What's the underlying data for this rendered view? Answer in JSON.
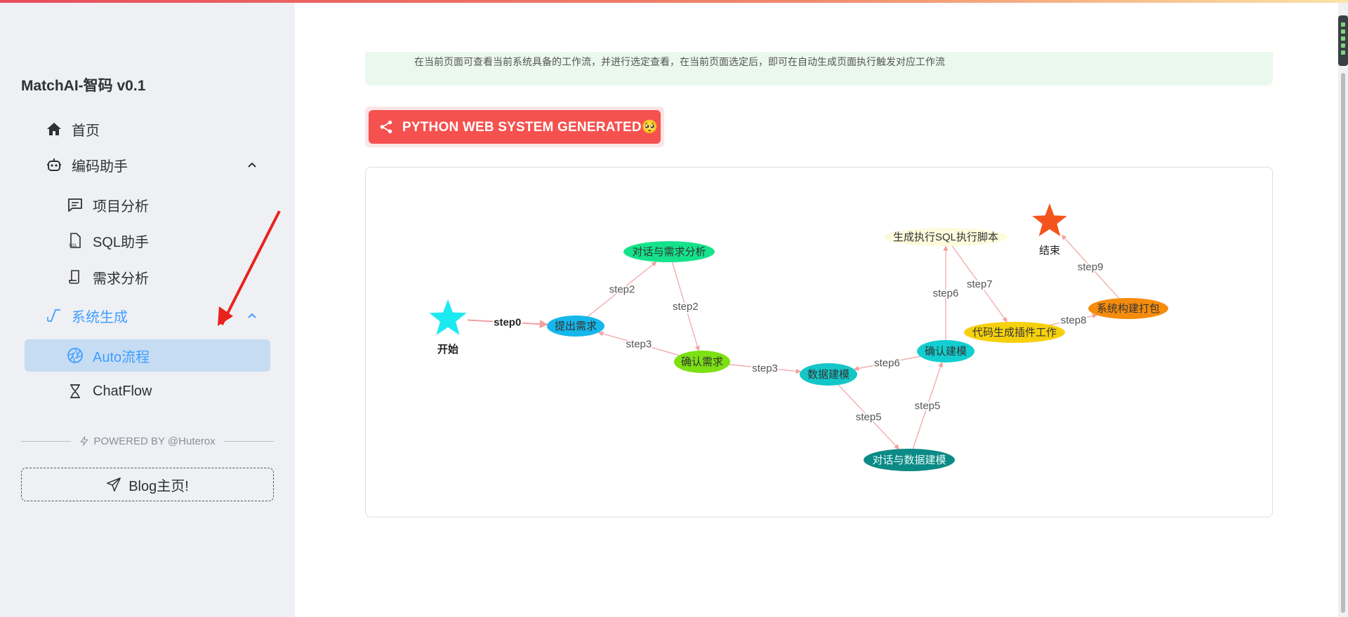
{
  "sidebar": {
    "brand": "MatchAI-智码 v0.1",
    "items": {
      "home": "首页",
      "coding_assistant": "编码助手",
      "project_analysis": "项目分析",
      "sql_assistant": "SQL助手",
      "requirement_analysis": "需求分析",
      "system_generation": "系统生成",
      "auto_flow": "Auto流程",
      "chatflow": "ChatFlow"
    },
    "powered_by": "POWERED BY @Huterox",
    "blog_button": "Blog主页!",
    "accent_color": "#409eff",
    "active_bg": "#c6dcf2"
  },
  "main": {
    "alert_text": "在当前页面可查看当前系统具备的工作流，并进行选定查看，在当前页面选定后，即可在自动生成页面执行触发对应工作流",
    "generate_button": "PYTHON WEB SYSTEM GENERATED🥺",
    "generate_button_color": "#f5514f"
  },
  "graph": {
    "nodes": [
      {
        "id": "start",
        "label": "开始",
        "shape": "star",
        "color": "#1de9f0"
      },
      {
        "id": "raise",
        "label": "提出需求",
        "color": "#16b7ea"
      },
      {
        "id": "dialog_req",
        "label": "对话与需求分析",
        "color": "#15e38b"
      },
      {
        "id": "confirm_req",
        "label": "确认需求",
        "color": "#7ce013"
      },
      {
        "id": "data_model",
        "label": "数据建模",
        "color": "#14c6c8"
      },
      {
        "id": "dialog_data",
        "label": "对话与数据建模",
        "color": "#0b8a86"
      },
      {
        "id": "confirm_model",
        "label": "确认建模",
        "color": "#13ced0"
      },
      {
        "id": "sql_script",
        "label": "生成执行SQL执行脚本",
        "color": "#fdfbdc"
      },
      {
        "id": "code_gen",
        "label": "代码生成插件工作",
        "color": "#f5d10d"
      },
      {
        "id": "build",
        "label": "系统构建打包",
        "color": "#f68c0c"
      },
      {
        "id": "end",
        "label": "结束",
        "shape": "star",
        "color": "#f4541c"
      }
    ],
    "edges": [
      {
        "from": "start",
        "to": "raise",
        "label": "step0",
        "bold": true
      },
      {
        "from": "raise",
        "to": "dialog_req",
        "label": "step2"
      },
      {
        "from": "dialog_req",
        "to": "confirm_req",
        "label": "step2"
      },
      {
        "from": "confirm_req",
        "to": "raise",
        "label": "step3"
      },
      {
        "from": "confirm_req",
        "to": "data_model",
        "label": "step3"
      },
      {
        "from": "data_model",
        "to": "dialog_data",
        "label": "step5"
      },
      {
        "from": "dialog_data",
        "to": "confirm_model",
        "label": "step5"
      },
      {
        "from": "confirm_model",
        "to": "data_model",
        "label": "step6"
      },
      {
        "from": "confirm_model",
        "to": "sql_script",
        "label": "step6"
      },
      {
        "from": "sql_script",
        "to": "code_gen",
        "label": "step7"
      },
      {
        "from": "code_gen",
        "to": "build",
        "label": "step8"
      },
      {
        "from": "build",
        "to": "end",
        "label": "step9"
      }
    ]
  }
}
